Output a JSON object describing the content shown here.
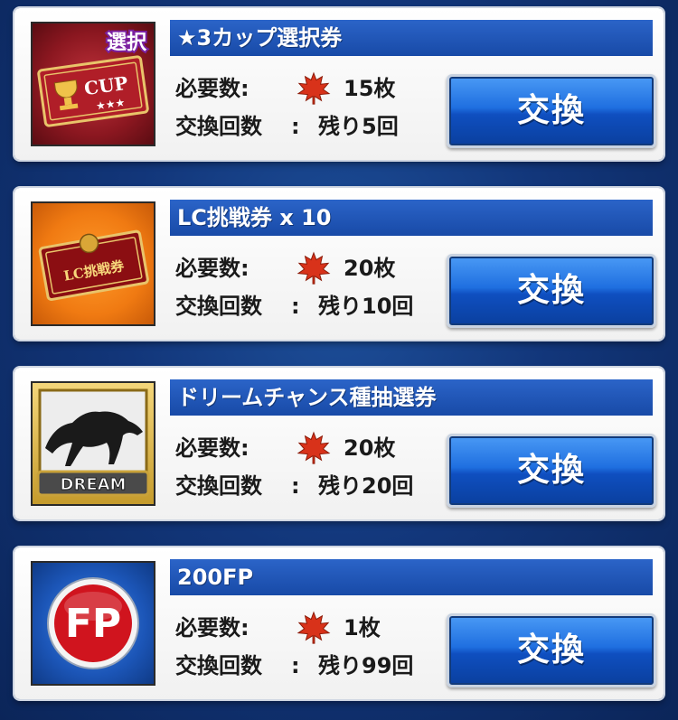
{
  "cost_label": "必要数:",
  "count_label": "交換回数",
  "colon": ":",
  "items": [
    {
      "title": "★3カップ選択券",
      "cost": "15枚",
      "remaining": "残り5回",
      "button": "交換",
      "thumb_text": [
        "選択",
        "CUP",
        "★★★"
      ]
    },
    {
      "title": "LC挑戦券 x 10",
      "cost": "20枚",
      "remaining": "残り10回",
      "button": "交換",
      "thumb_text": [
        "LC挑戦券"
      ]
    },
    {
      "title": "ドリームチャンス種抽選券",
      "cost": "20枚",
      "remaining": "残り20回",
      "button": "交換",
      "thumb_text": [
        "DREAM"
      ]
    },
    {
      "title": "200FP",
      "cost": "1枚",
      "remaining": "残り99回",
      "button": "交換",
      "thumb_text": [
        "FP"
      ]
    }
  ],
  "colors": {
    "title_bar": "#184aa7",
    "button": "#1f6fe0",
    "background": "#12367a",
    "maple": "#d8321a"
  }
}
